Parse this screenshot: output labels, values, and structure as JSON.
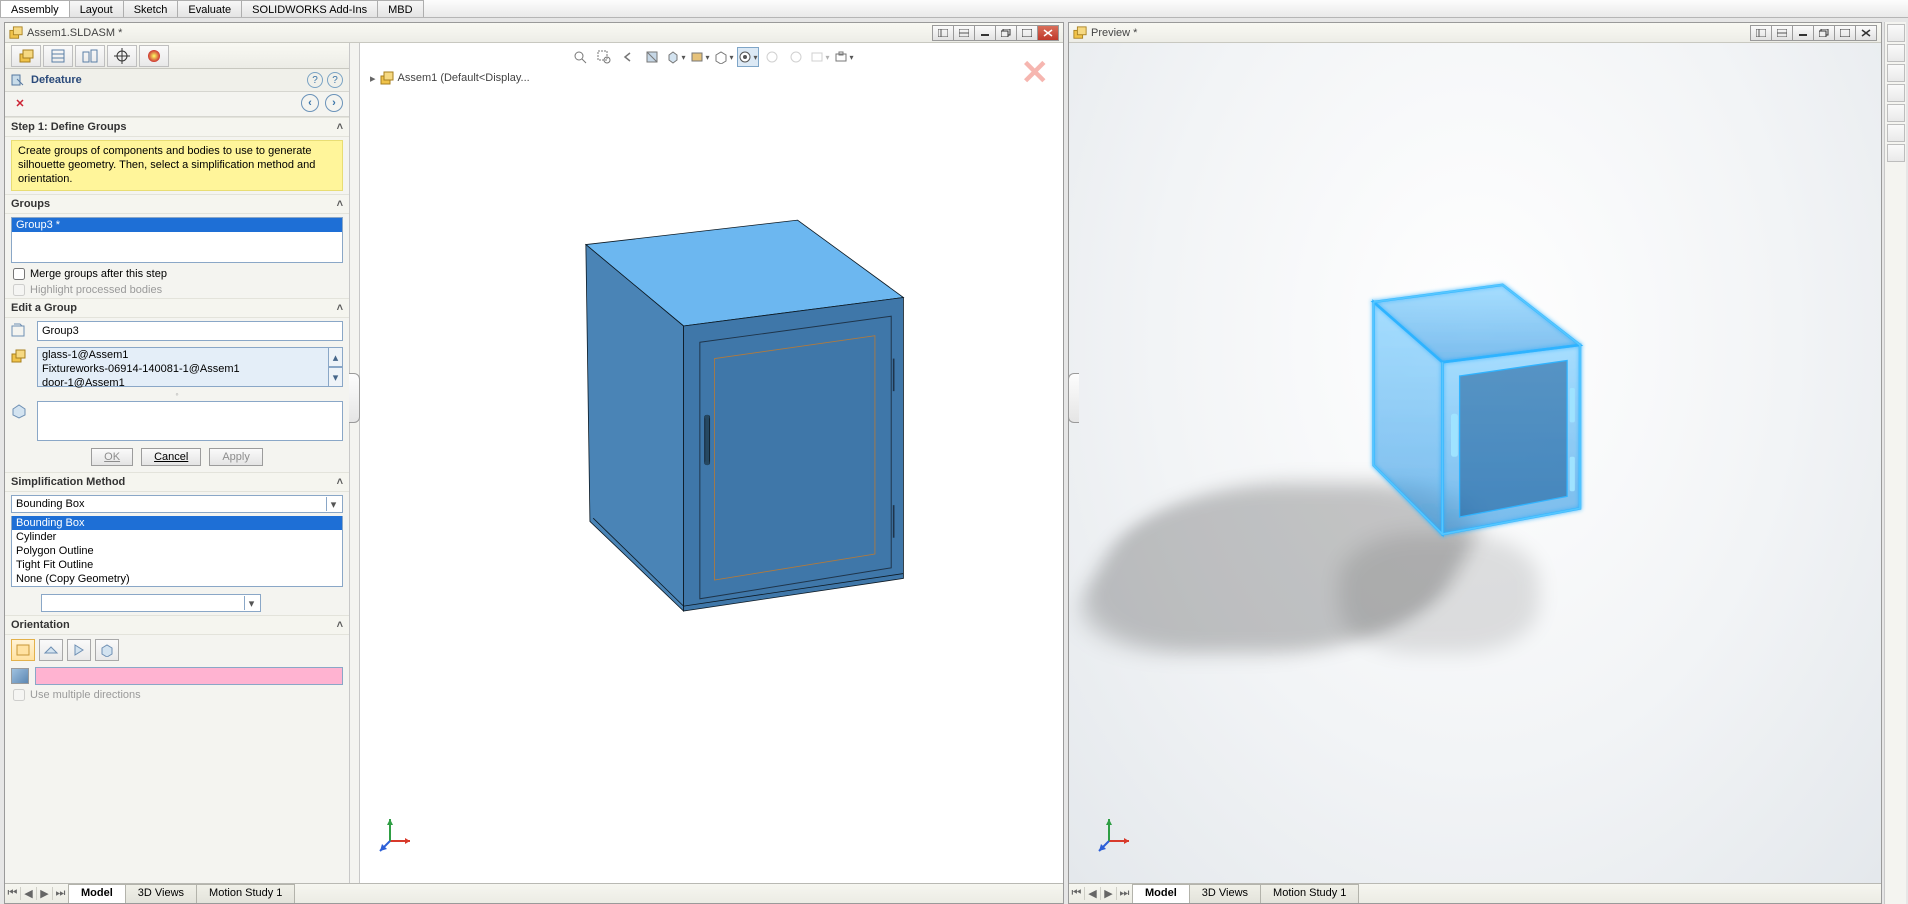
{
  "ribbon": {
    "tabs": [
      "Assembly",
      "Layout",
      "Sketch",
      "Evaluate",
      "SOLIDWORKS Add-Ins",
      "MBD"
    ],
    "active": 0
  },
  "windows": {
    "main": {
      "title": "Assem1.SLDASM *"
    },
    "preview": {
      "title": "Preview *"
    }
  },
  "breadcrumb": {
    "label": "Assem1  (Default<Display..."
  },
  "panel": {
    "feature_name": "Defeature",
    "step_title": "Step 1: Define Groups",
    "instruction": "Create groups of components and bodies to use to generate silhouette geometry. Then, select a simplification method and orientation.",
    "groups_header": "Groups",
    "groups": [
      "Group3 *"
    ],
    "merge_label": "Merge groups after this step",
    "highlight_label": "Highlight processed bodies",
    "edit_header": "Edit a Group",
    "group_name": "Group3",
    "components": [
      "glass-1@Assem1",
      "Fixtureworks-06914-140081-1@Assem1",
      "door-1@Assem1"
    ],
    "buttons": {
      "ok": "OK",
      "cancel": "Cancel",
      "apply": "Apply"
    },
    "simp_header": "Simplification Method",
    "simp_selected": "Bounding Box",
    "simp_options": [
      "Bounding Box",
      "Cylinder",
      "Polygon Outline",
      "Tight Fit Outline",
      "None (Copy Geometry)"
    ],
    "orient_header": "Orientation",
    "multiple_dir_label": "Use multiple directions"
  },
  "bottom_tabs": {
    "tabs": [
      "Model",
      "3D Views",
      "Motion Study 1"
    ],
    "active": 0
  },
  "colors": {
    "accent": "#1e6fd6",
    "instruction_bg": "#fff59a",
    "cab_top": "#6cb7f0",
    "cab_front": "#3f77a9",
    "cab_side": "#4a84b6",
    "preview_glow": "#2fb3ff"
  }
}
